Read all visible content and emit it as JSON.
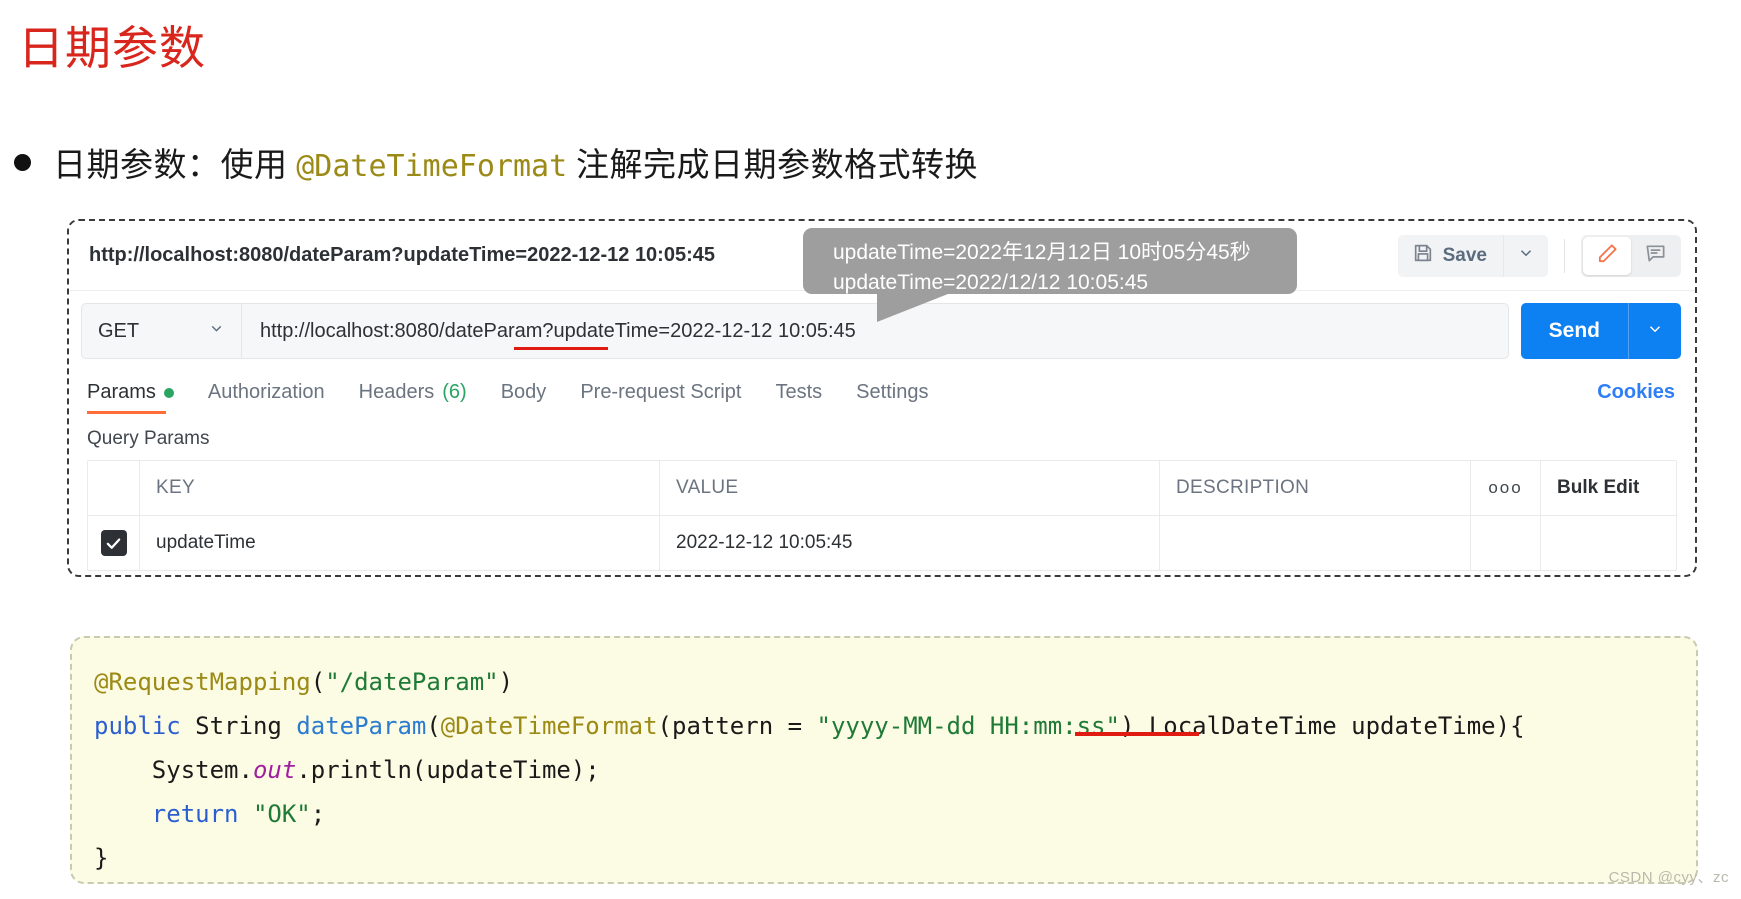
{
  "slide": {
    "title": "日期参数",
    "bullet": {
      "prefix": "日期参数：使用 ",
      "annotation": "@DateTimeFormat",
      "suffix": " 注解完成日期参数格式转换"
    }
  },
  "postman": {
    "request_name": "http://localhost:8080/dateParam?updateTime=2022-12-12 10:05:45",
    "save_label": "Save",
    "method": "GET",
    "url": "http://localhost:8080/dateParam?updateTime=2022-12-12 10:05:45",
    "send_label": "Send",
    "tabs": [
      {
        "label": "Params",
        "active": true,
        "dot": true
      },
      {
        "label": "Authorization",
        "active": false
      },
      {
        "label": "Headers",
        "count": "(6)",
        "active": false
      },
      {
        "label": "Body",
        "active": false
      },
      {
        "label": "Pre-request Script",
        "active": false
      },
      {
        "label": "Tests",
        "active": false
      },
      {
        "label": "Settings",
        "active": false
      }
    ],
    "cookies_label": "Cookies",
    "section_label": "Query Params",
    "table": {
      "headers": {
        "key": "KEY",
        "value": "VALUE",
        "description": "DESCRIPTION",
        "more": "ooo",
        "bulk_edit": "Bulk Edit"
      },
      "rows": [
        {
          "checked": true,
          "key": "updateTime",
          "value": "2022-12-12 10:05:45",
          "description": ""
        }
      ]
    }
  },
  "callout": {
    "line1": "updateTime=2022年12月12日 10时05分45秒",
    "line2": "updateTime=2022/12/12 10:05:45"
  },
  "code": {
    "line1": {
      "anno": "@RequestMapping",
      "open": "(",
      "str": "\"/dateParam\"",
      "close": ")"
    },
    "line2": {
      "kw": "public",
      "type": " String ",
      "fn": "dateParam",
      "p1": "(",
      "anno": "@DateTimeFormat",
      "p2": "(pattern = ",
      "str": "\"yyyy-MM-dd HH:mm:ss\"",
      "p3": ") LocalDateTime updateTime){"
    },
    "line3": {
      "a": "    System.",
      "field": "out",
      "b": ".println(updateTime);"
    },
    "line4": {
      "kw": "    return ",
      "str": "\"OK\"",
      "semi": ";"
    },
    "line5": "}"
  },
  "watermark": "CSDN @cyy、zc",
  "colors": {
    "title_red": "#d9261c",
    "accent_orange": "#ff6c37",
    "send_blue": "#0d80f2",
    "link_blue": "#2f7ef5",
    "green": "#2aa463",
    "underline_red": "#e01b12",
    "code_bg": "#fcfbe3",
    "callout_gray": "#9e9e9e"
  }
}
